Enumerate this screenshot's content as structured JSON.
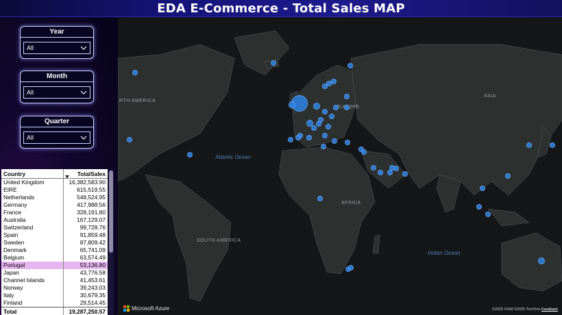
{
  "header": {
    "title": "EDA E-Commerce - Total Sales MAP"
  },
  "slicers": [
    {
      "label": "Year",
      "value": "All"
    },
    {
      "label": "Month",
      "value": "All"
    },
    {
      "label": "Quarter",
      "value": "All"
    }
  ],
  "table": {
    "col_country": "Country",
    "col_sales": "TotalSales",
    "rows": [
      {
        "country": "United Kingdom",
        "sales": "16,382,583.90"
      },
      {
        "country": "EIRE",
        "sales": "615,519.55"
      },
      {
        "country": "Netherlands",
        "sales": "548,524.95"
      },
      {
        "country": "Germany",
        "sales": "417,988.56"
      },
      {
        "country": "France",
        "sales": "328,191.80"
      },
      {
        "country": "Australia",
        "sales": "167,129.07"
      },
      {
        "country": "Switzerland",
        "sales": "99,728.76"
      },
      {
        "country": "Spain",
        "sales": "91,859.48"
      },
      {
        "country": "Sweden",
        "sales": "87,809.42"
      },
      {
        "country": "Denmark",
        "sales": "65,741.09"
      },
      {
        "country": "Belgium",
        "sales": "63,574.49"
      },
      {
        "country": "Portugal",
        "sales": "53,136.80"
      },
      {
        "country": "Japan",
        "sales": "43,776.58"
      },
      {
        "country": "Channel Islands",
        "sales": "41,453.61"
      },
      {
        "country": "Norway",
        "sales": "39,243.03"
      },
      {
        "country": "Italy",
        "sales": "30,679.35"
      },
      {
        "country": "Finland",
        "sales": "29,514.45"
      }
    ],
    "total_label": "Total",
    "total_value": "19,287,250.57"
  },
  "map": {
    "regions": [
      "RTH AMERICA",
      "EUROPE",
      "ASIA",
      "AFRICA",
      "SOUTH AMERICA"
    ],
    "oceans": [
      "Atlantic Ocean",
      "Indian Ocean"
    ],
    "logo": "Microsoft Azure",
    "attribution": "©2025 OSM  ©2025 TomTom",
    "feedback": "Feedback",
    "bubble_color": "#2d82e6"
  },
  "colors": {
    "accent": "#1d1a8c",
    "highlight": "#e6b6f0"
  }
}
